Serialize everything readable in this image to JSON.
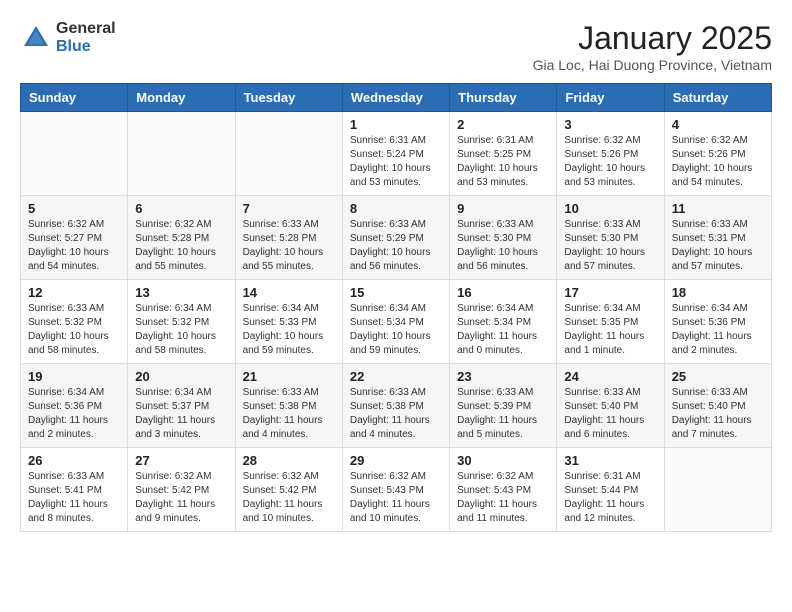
{
  "logo": {
    "general": "General",
    "blue": "Blue"
  },
  "header": {
    "month": "January 2025",
    "location": "Gia Loc, Hai Duong Province, Vietnam"
  },
  "weekdays": [
    "Sunday",
    "Monday",
    "Tuesday",
    "Wednesday",
    "Thursday",
    "Friday",
    "Saturday"
  ],
  "weeks": [
    [
      {
        "day": "",
        "info": ""
      },
      {
        "day": "",
        "info": ""
      },
      {
        "day": "",
        "info": ""
      },
      {
        "day": "1",
        "info": "Sunrise: 6:31 AM\nSunset: 5:24 PM\nDaylight: 10 hours\nand 53 minutes."
      },
      {
        "day": "2",
        "info": "Sunrise: 6:31 AM\nSunset: 5:25 PM\nDaylight: 10 hours\nand 53 minutes."
      },
      {
        "day": "3",
        "info": "Sunrise: 6:32 AM\nSunset: 5:26 PM\nDaylight: 10 hours\nand 53 minutes."
      },
      {
        "day": "4",
        "info": "Sunrise: 6:32 AM\nSunset: 5:26 PM\nDaylight: 10 hours\nand 54 minutes."
      }
    ],
    [
      {
        "day": "5",
        "info": "Sunrise: 6:32 AM\nSunset: 5:27 PM\nDaylight: 10 hours\nand 54 minutes."
      },
      {
        "day": "6",
        "info": "Sunrise: 6:32 AM\nSunset: 5:28 PM\nDaylight: 10 hours\nand 55 minutes."
      },
      {
        "day": "7",
        "info": "Sunrise: 6:33 AM\nSunset: 5:28 PM\nDaylight: 10 hours\nand 55 minutes."
      },
      {
        "day": "8",
        "info": "Sunrise: 6:33 AM\nSunset: 5:29 PM\nDaylight: 10 hours\nand 56 minutes."
      },
      {
        "day": "9",
        "info": "Sunrise: 6:33 AM\nSunset: 5:30 PM\nDaylight: 10 hours\nand 56 minutes."
      },
      {
        "day": "10",
        "info": "Sunrise: 6:33 AM\nSunset: 5:30 PM\nDaylight: 10 hours\nand 57 minutes."
      },
      {
        "day": "11",
        "info": "Sunrise: 6:33 AM\nSunset: 5:31 PM\nDaylight: 10 hours\nand 57 minutes."
      }
    ],
    [
      {
        "day": "12",
        "info": "Sunrise: 6:33 AM\nSunset: 5:32 PM\nDaylight: 10 hours\nand 58 minutes."
      },
      {
        "day": "13",
        "info": "Sunrise: 6:34 AM\nSunset: 5:32 PM\nDaylight: 10 hours\nand 58 minutes."
      },
      {
        "day": "14",
        "info": "Sunrise: 6:34 AM\nSunset: 5:33 PM\nDaylight: 10 hours\nand 59 minutes."
      },
      {
        "day": "15",
        "info": "Sunrise: 6:34 AM\nSunset: 5:34 PM\nDaylight: 10 hours\nand 59 minutes."
      },
      {
        "day": "16",
        "info": "Sunrise: 6:34 AM\nSunset: 5:34 PM\nDaylight: 11 hours\nand 0 minutes."
      },
      {
        "day": "17",
        "info": "Sunrise: 6:34 AM\nSunset: 5:35 PM\nDaylight: 11 hours\nand 1 minute."
      },
      {
        "day": "18",
        "info": "Sunrise: 6:34 AM\nSunset: 5:36 PM\nDaylight: 11 hours\nand 2 minutes."
      }
    ],
    [
      {
        "day": "19",
        "info": "Sunrise: 6:34 AM\nSunset: 5:36 PM\nDaylight: 11 hours\nand 2 minutes."
      },
      {
        "day": "20",
        "info": "Sunrise: 6:34 AM\nSunset: 5:37 PM\nDaylight: 11 hours\nand 3 minutes."
      },
      {
        "day": "21",
        "info": "Sunrise: 6:33 AM\nSunset: 5:38 PM\nDaylight: 11 hours\nand 4 minutes."
      },
      {
        "day": "22",
        "info": "Sunrise: 6:33 AM\nSunset: 5:38 PM\nDaylight: 11 hours\nand 4 minutes."
      },
      {
        "day": "23",
        "info": "Sunrise: 6:33 AM\nSunset: 5:39 PM\nDaylight: 11 hours\nand 5 minutes."
      },
      {
        "day": "24",
        "info": "Sunrise: 6:33 AM\nSunset: 5:40 PM\nDaylight: 11 hours\nand 6 minutes."
      },
      {
        "day": "25",
        "info": "Sunrise: 6:33 AM\nSunset: 5:40 PM\nDaylight: 11 hours\nand 7 minutes."
      }
    ],
    [
      {
        "day": "26",
        "info": "Sunrise: 6:33 AM\nSunset: 5:41 PM\nDaylight: 11 hours\nand 8 minutes."
      },
      {
        "day": "27",
        "info": "Sunrise: 6:32 AM\nSunset: 5:42 PM\nDaylight: 11 hours\nand 9 minutes."
      },
      {
        "day": "28",
        "info": "Sunrise: 6:32 AM\nSunset: 5:42 PM\nDaylight: 11 hours\nand 10 minutes."
      },
      {
        "day": "29",
        "info": "Sunrise: 6:32 AM\nSunset: 5:43 PM\nDaylight: 11 hours\nand 10 minutes."
      },
      {
        "day": "30",
        "info": "Sunrise: 6:32 AM\nSunset: 5:43 PM\nDaylight: 11 hours\nand 11 minutes."
      },
      {
        "day": "31",
        "info": "Sunrise: 6:31 AM\nSunset: 5:44 PM\nDaylight: 11 hours\nand 12 minutes."
      },
      {
        "day": "",
        "info": ""
      }
    ]
  ]
}
